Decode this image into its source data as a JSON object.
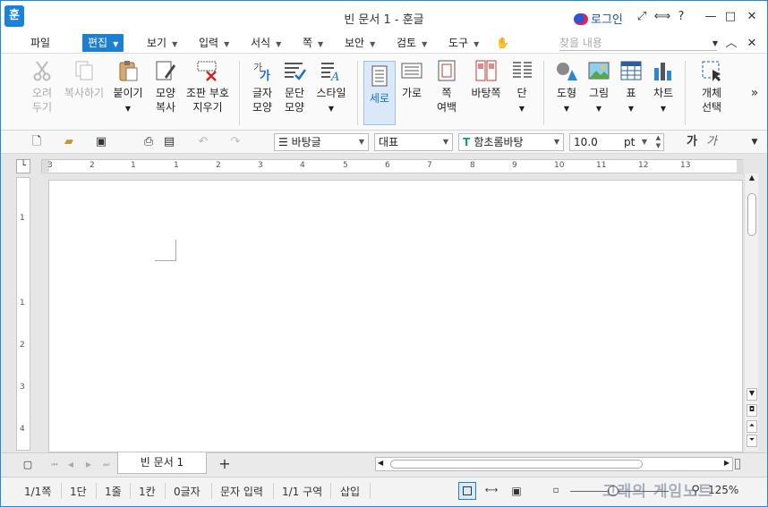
{
  "app": {
    "logo": "훈",
    "title": "빈 문서 1 - 훈글",
    "login": "로그인"
  },
  "window_controls": {
    "fullscreen": "⤢",
    "split": "⟺",
    "help": "?",
    "minimize": "—",
    "maximize": "□",
    "close": "✕"
  },
  "menu": {
    "file": "파일",
    "items": [
      "편집",
      "보기",
      "입력",
      "서식",
      "쪽",
      "보안",
      "검토",
      "도구"
    ],
    "search_placeholder": "찾을 내용"
  },
  "ribbon": {
    "cut": "오려\n두기",
    "copy": "복사하기",
    "paste": "붙이기",
    "format_copy": "모양\n복사",
    "clear_marks": "조판 부호\n지우기",
    "char_shape": "글자\n모양",
    "para_shape": "문단\n모양",
    "style": "스타일",
    "portrait": "세로",
    "landscape": "가로",
    "margin": "쪽\n여백",
    "background": "바탕쪽",
    "columns": "단",
    "shapes": "도형",
    "picture": "그림",
    "table": "표",
    "chart": "차트",
    "select_object": "개체\n선택"
  },
  "toolbar": {
    "style_value": "바탕글",
    "lang_value": "대표",
    "font_value": "함초롬바탕",
    "size_value": "10.0",
    "unit_value": "pt",
    "bold_label": "가",
    "italic_label": "가"
  },
  "ruler": {
    "h_ticks": [
      "3",
      "2",
      "1",
      "1",
      "2",
      "3",
      "4",
      "5",
      "6",
      "7",
      "8",
      "9",
      "10",
      "11",
      "12",
      "13"
    ],
    "v_ticks": [
      "1",
      "1",
      "2",
      "3",
      "4"
    ]
  },
  "tabs": {
    "doc_tab": "빈 문서 1",
    "add": "+"
  },
  "status": {
    "page": "1/1쪽",
    "section": "1단",
    "line": "1줄",
    "column": "1칸",
    "chars": "0글자",
    "mode": "문자 입력",
    "zone": "1/1 구역",
    "insert": "삽입",
    "zoom": "125%"
  },
  "watermark": "고래의 게임노트",
  "colors": {
    "accent": "#1e7fd0",
    "login": "#1c4fb0"
  }
}
